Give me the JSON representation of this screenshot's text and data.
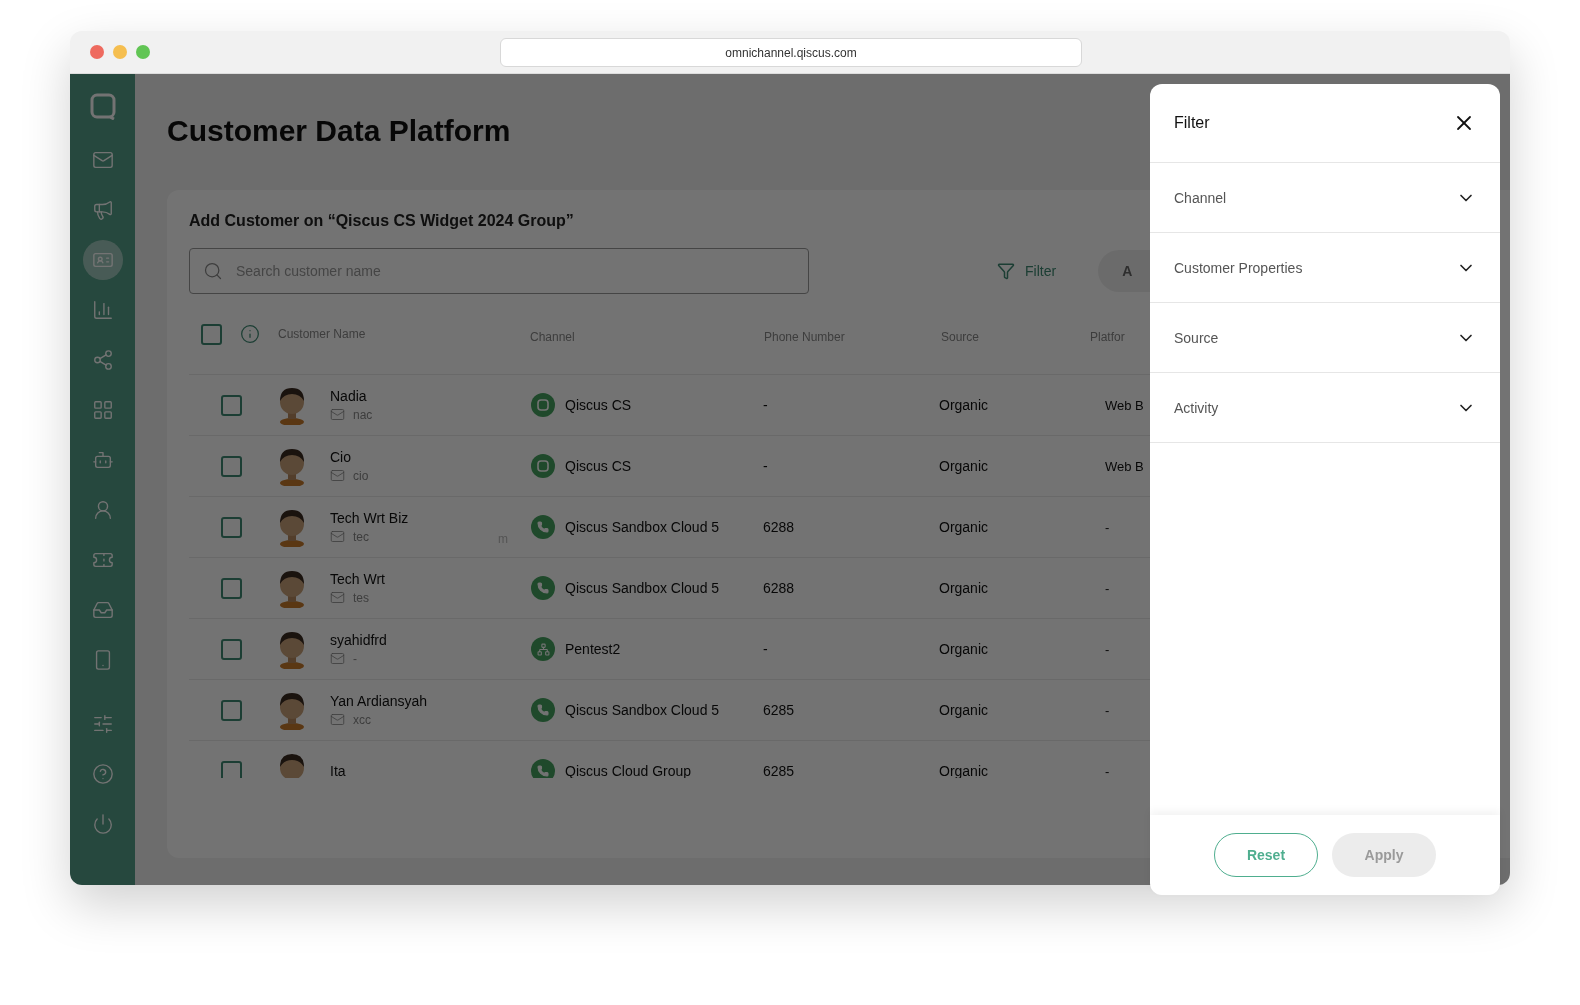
{
  "browser": {
    "url": "omnichannel.qiscus.com"
  },
  "sidebar": {
    "items": [
      {
        "selected": false
      },
      {
        "selected": false
      },
      {
        "selected": true
      },
      {
        "selected": false
      },
      {
        "selected": false
      },
      {
        "selected": false
      },
      {
        "selected": false
      },
      {
        "selected": false
      },
      {
        "selected": false
      },
      {
        "selected": false
      },
      {
        "selected": false
      }
    ],
    "bottom_items": [
      {
        "selected": false
      },
      {
        "selected": false
      },
      {
        "selected": false
      }
    ]
  },
  "page": {
    "title": "Customer Data Platform"
  },
  "card": {
    "title": "Add Customer on “Qiscus CS Widget 2024 Group”",
    "search": {
      "placeholder": "Search customer name"
    },
    "filter_button": "Filter",
    "add_button": "A"
  },
  "table": {
    "select_all": {
      "checked": false
    },
    "columns": [
      "Customer Name",
      "Channel",
      "Phone Number",
      "Source",
      "Platfor"
    ],
    "rows": [
      {
        "checked": false,
        "name": "Nadia",
        "email": "nac",
        "channel": {
          "kind": "qiscus",
          "name": "Qiscus CS"
        },
        "phone": "-",
        "source": "Organic",
        "platform": "Web B"
      },
      {
        "checked": false,
        "name": "Cio",
        "email": "cio",
        "channel": {
          "kind": "qiscus",
          "name": "Qiscus CS"
        },
        "phone": "-",
        "source": "Organic",
        "platform": "Web B"
      },
      {
        "checked": false,
        "name": "Tech Wrt Biz",
        "email": "tec",
        "email_tail": "m",
        "channel": {
          "kind": "whatsapp",
          "name": "Qiscus Sandbox Cloud 5"
        },
        "phone": "6288",
        "source": "Organic",
        "platform": "-"
      },
      {
        "checked": false,
        "name": "Tech Wrt",
        "email": "tes",
        "channel": {
          "kind": "whatsapp",
          "name": "Qiscus Sandbox Cloud 5"
        },
        "phone": "6288",
        "source": "Organic",
        "platform": "-"
      },
      {
        "checked": false,
        "name": "syahidfrd",
        "email": "-",
        "channel": {
          "kind": "pentest",
          "name": "Pentest2"
        },
        "phone": "-",
        "source": "Organic",
        "platform": "-"
      },
      {
        "checked": false,
        "name": "Yan Ardiansyah",
        "email": "xcc",
        "channel": {
          "kind": "whatsapp",
          "name": "Qiscus Sandbox Cloud 5"
        },
        "phone": "6285",
        "source": "Organic",
        "platform": "-"
      },
      {
        "checked": false,
        "name": "Ita",
        "channel": {
          "kind": "whatsapp",
          "name": "Qiscus Cloud Group"
        },
        "phone": "6285",
        "source": "Organic",
        "platform": "-"
      }
    ]
  },
  "filter_panel": {
    "title": "Filter",
    "sections": [
      {
        "label": "Channel",
        "expanded": false
      },
      {
        "label": "Customer Properties",
        "expanded": false
      },
      {
        "label": "Source",
        "expanded": false
      },
      {
        "label": "Activity",
        "expanded": false
      }
    ],
    "reset_button": "Reset",
    "apply_button": {
      "label": "Apply",
      "disabled": true
    }
  }
}
